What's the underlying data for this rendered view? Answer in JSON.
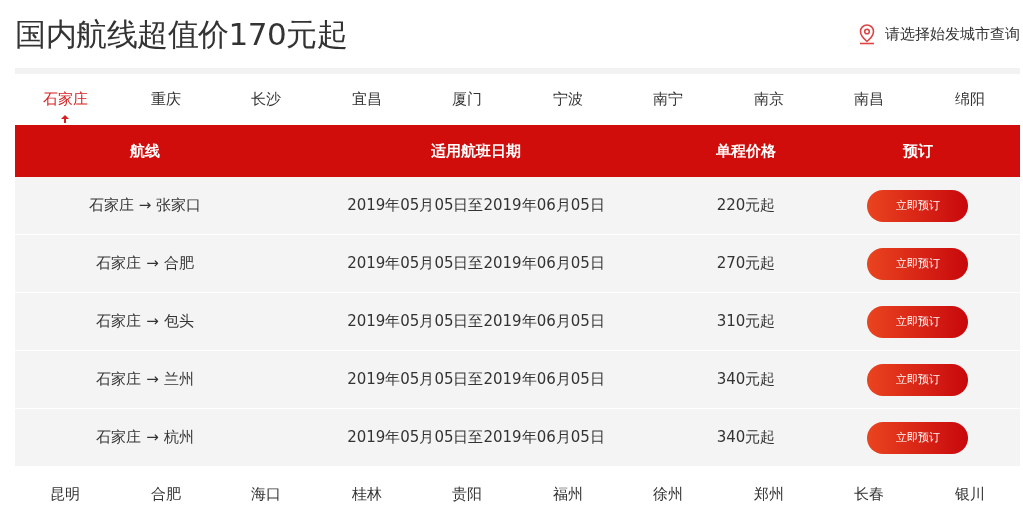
{
  "title": "国内航线超值价170元起",
  "city_picker": {
    "label": "请选择始发城市查询"
  },
  "tabs": [
    {
      "label": "石家庄",
      "selected": true
    },
    {
      "label": "重庆",
      "selected": false
    },
    {
      "label": "长沙",
      "selected": false
    },
    {
      "label": "宜昌",
      "selected": false
    },
    {
      "label": "厦门",
      "selected": false
    },
    {
      "label": "宁波",
      "selected": false
    },
    {
      "label": "南宁",
      "selected": false
    },
    {
      "label": "南京",
      "selected": false
    },
    {
      "label": "南昌",
      "selected": false
    },
    {
      "label": "绵阳",
      "selected": false
    }
  ],
  "table": {
    "columns": [
      "航线",
      "适用航班日期",
      "单程价格",
      "预订"
    ],
    "rows": [
      {
        "from": "石家庄",
        "arrow": "→",
        "to": "张家口",
        "dates": "2019年05月05日至2019年06月05日",
        "price": "220元起",
        "action": "立即预订"
      },
      {
        "from": "石家庄",
        "arrow": "→",
        "to": "合肥",
        "dates": "2019年05月05日至2019年06月05日",
        "price": "270元起",
        "action": "立即预订"
      },
      {
        "from": "石家庄",
        "arrow": "→",
        "to": "包头",
        "dates": "2019年05月05日至2019年06月05日",
        "price": "310元起",
        "action": "立即预订"
      },
      {
        "from": "石家庄",
        "arrow": "→",
        "to": "兰州",
        "dates": "2019年05月05日至2019年06月05日",
        "price": "340元起",
        "action": "立即预订"
      },
      {
        "from": "石家庄",
        "arrow": "→",
        "to": "杭州",
        "dates": "2019年05月05日至2019年06月05日",
        "price": "340元起",
        "action": "立即预订"
      }
    ]
  },
  "more_tabs": [
    {
      "label": "昆明",
      "selected": false
    },
    {
      "label": "合肥",
      "selected": false
    },
    {
      "label": "海口",
      "selected": false
    },
    {
      "label": "桂林",
      "selected": false
    },
    {
      "label": "贵阳",
      "selected": false
    },
    {
      "label": "福州",
      "selected": false
    },
    {
      "label": "徐州",
      "selected": false
    },
    {
      "label": "郑州",
      "selected": false
    },
    {
      "label": "长春",
      "selected": false
    },
    {
      "label": "银川",
      "selected": false
    }
  ]
}
